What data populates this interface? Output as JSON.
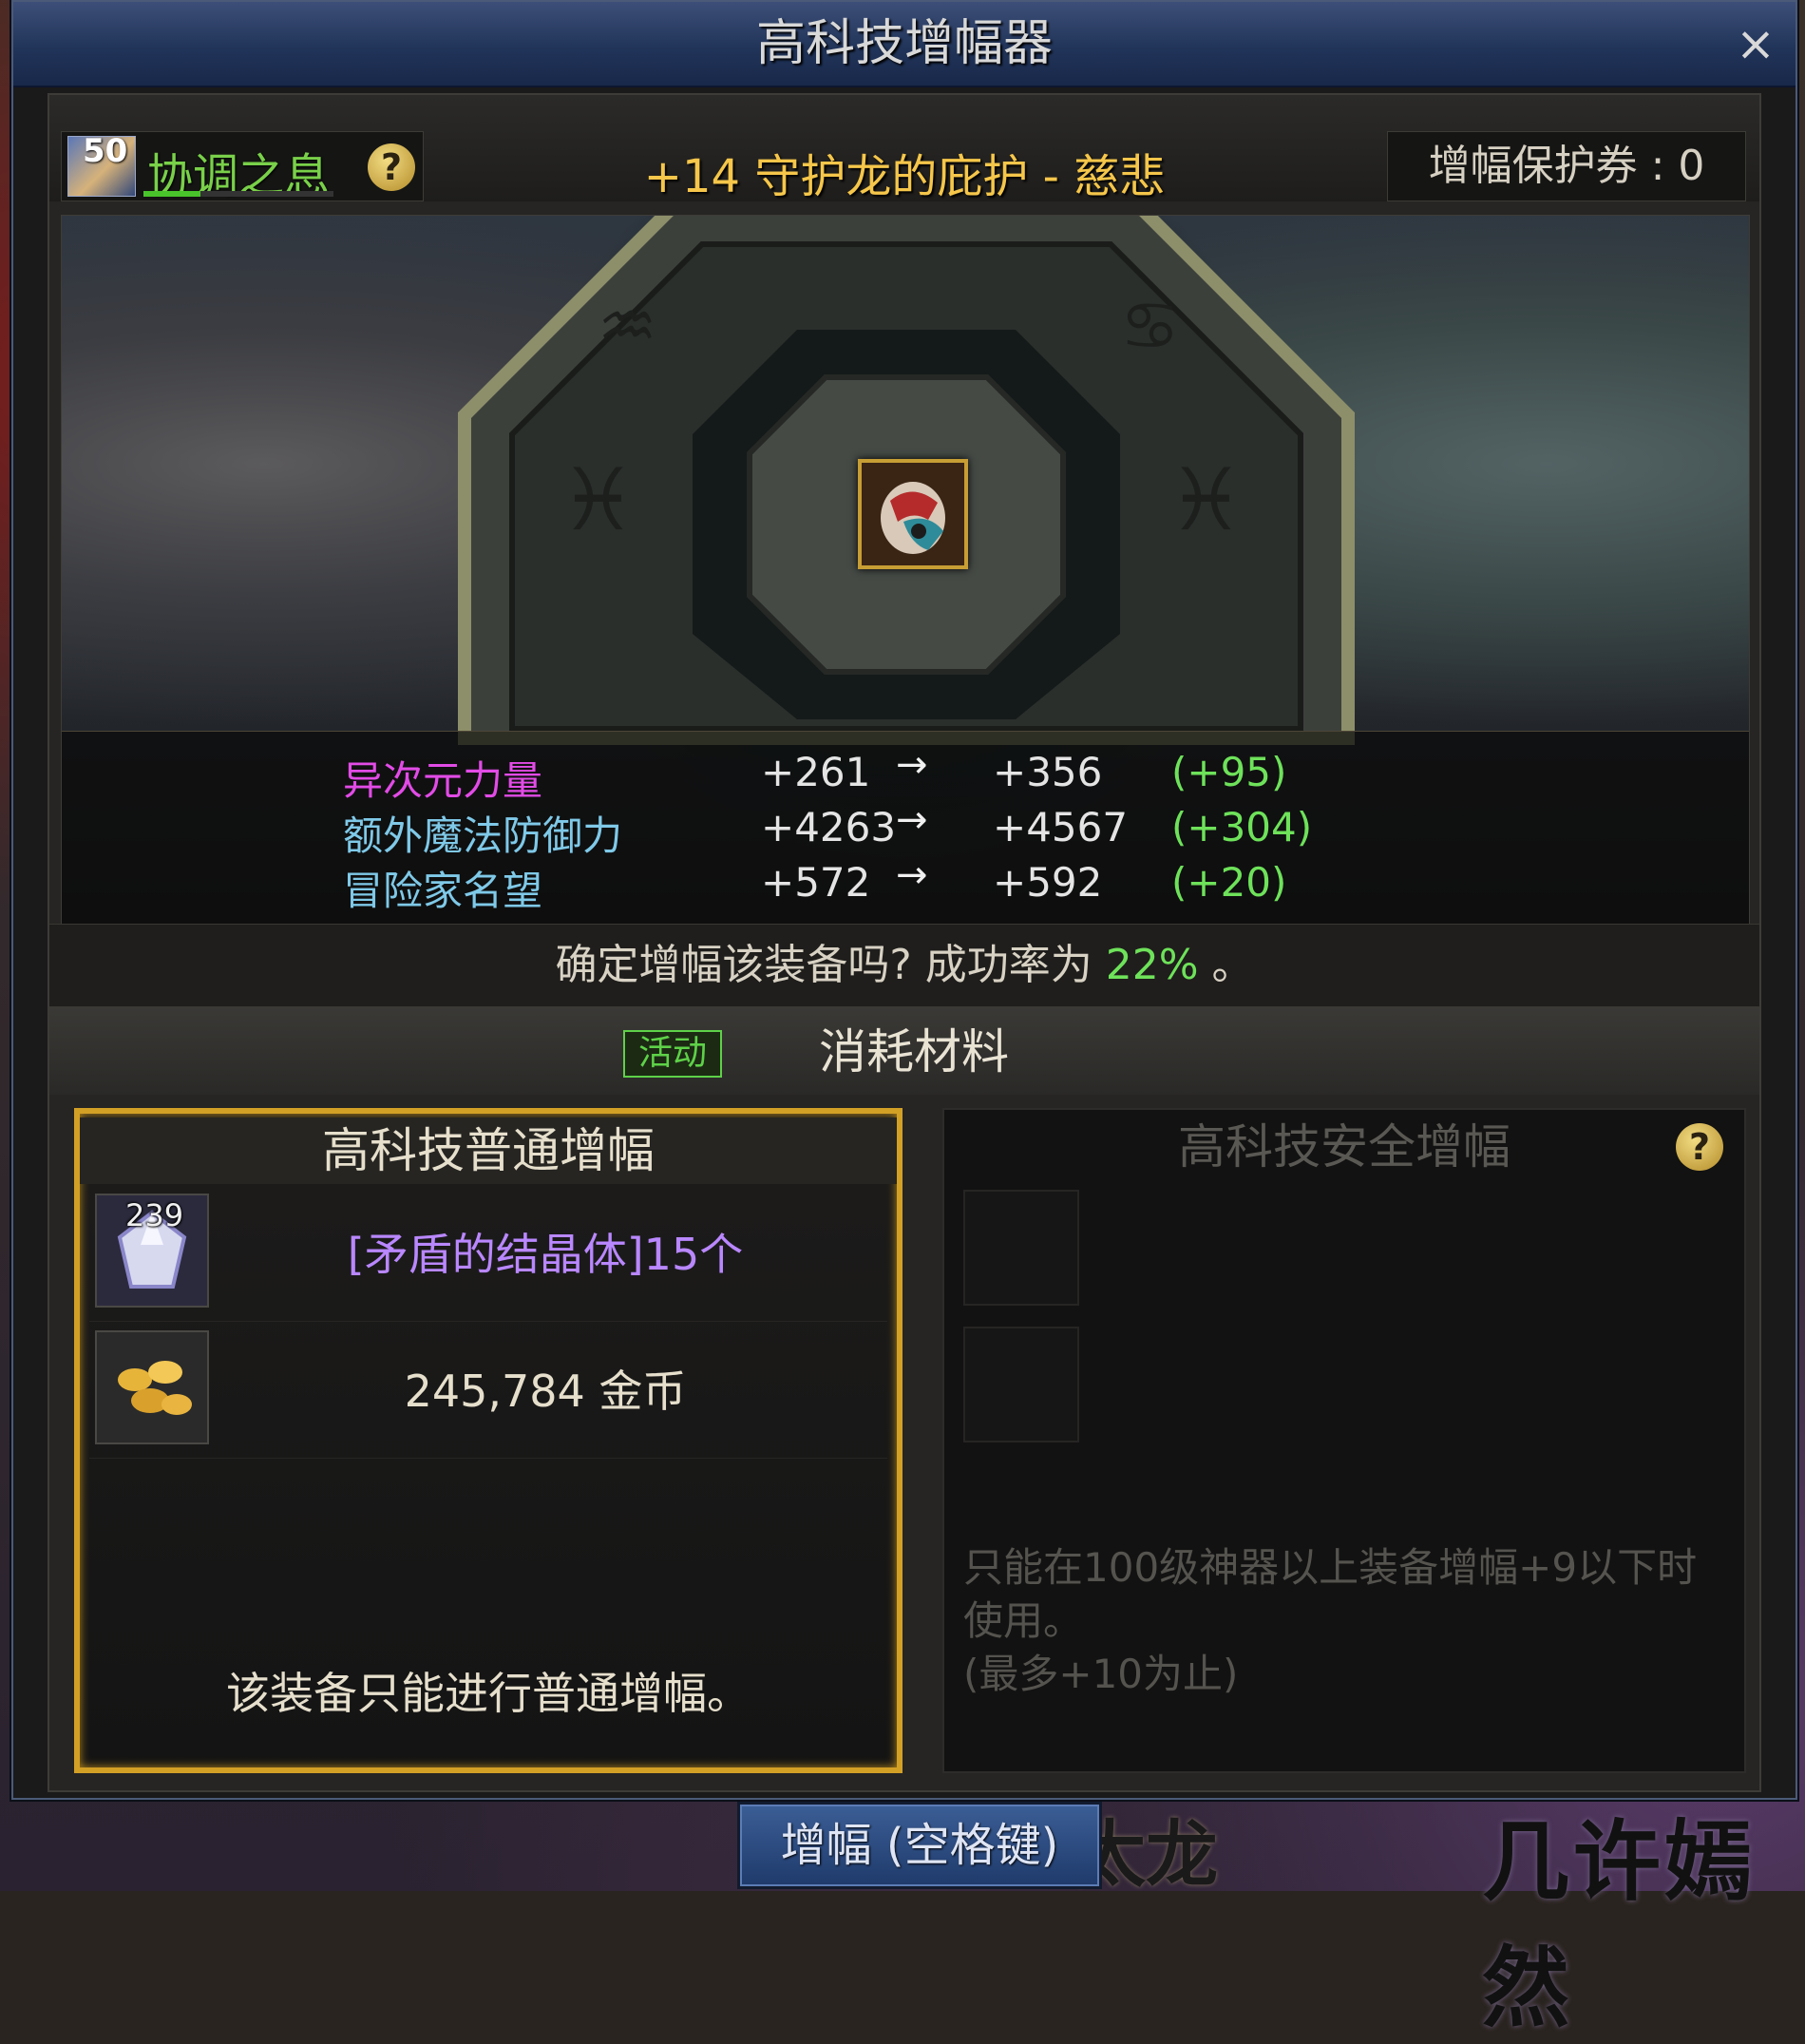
{
  "window": {
    "title": "高科技增幅器",
    "close_glyph": "×"
  },
  "background": {
    "text_right": "几许嫣然",
    "text_mid": "太龙"
  },
  "header": {
    "buff": {
      "level": "50",
      "name": "协调之息",
      "help": "?",
      "progress": 0.3
    },
    "item_name": "+14 守护龙的庇护 - 慈悲",
    "protection_ticket": "增幅保护券 : 0"
  },
  "stats": [
    {
      "name": "异次元力量",
      "old": "+261",
      "arrow": "→",
      "new": "+356",
      "diff": "(+95)",
      "color": "#e24be6"
    },
    {
      "name": "额外魔法防御力",
      "old": "+4263",
      "arrow": "→",
      "new": "+4567",
      "diff": "(+304)",
      "color": "#7fc9e8"
    },
    {
      "name": "冒险家名望",
      "old": "+572",
      "arrow": "→",
      "new": "+592",
      "diff": "(+20)",
      "color": "#7fc9e8"
    }
  ],
  "confirm": {
    "prefix": "确定增幅该装备吗? 成功率为 ",
    "rate": "22%",
    "suffix": " 。"
  },
  "tabs": {
    "activity": "活动",
    "materials": "消耗材料"
  },
  "normal_panel": {
    "title": "高科技普通增幅",
    "materials": [
      {
        "count": "239",
        "label": "[矛盾的结晶体]15个",
        "icon": "crystal-icon"
      },
      {
        "count": "",
        "label": "245,784 金币",
        "icon": "gold-coins-icon"
      }
    ],
    "note": "该装备只能进行普通增幅。"
  },
  "safe_panel": {
    "title": "高科技安全增幅",
    "help": "?",
    "desc_lines": [
      "只能在100级神器以上装备增幅+9以下时",
      "使用。",
      "(最多+10为止)"
    ]
  },
  "enhance_button": "增幅 (空格键)",
  "colors": {
    "accent_gold": "#d3a026",
    "success_green": "#6ee25a",
    "magic_purple": "#b987ff",
    "title_blue": "#213459"
  }
}
